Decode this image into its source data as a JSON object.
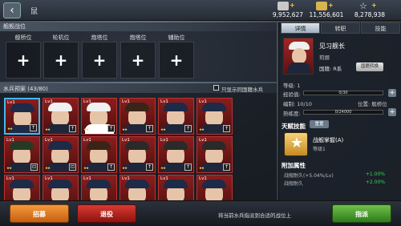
{
  "topbar": {
    "back_icon": "back-arrow-icon",
    "title": "鼠",
    "resources": [
      {
        "name": "fuel-icon",
        "value": "9,952,627",
        "color": "#d7d7d7"
      },
      {
        "name": "ammo-icon",
        "value": "11,556,601",
        "color": "#e0c060"
      },
      {
        "name": "star-icon",
        "value": "8,278,938",
        "color": "#e6e6e6"
      }
    ]
  },
  "formation": {
    "title": "舰舰战位",
    "slots": [
      {
        "label": "舰桥位",
        "plus": "+"
      },
      {
        "label": "轮机位",
        "plus": "+"
      },
      {
        "label": "炮塔位",
        "plus": "+"
      },
      {
        "label": "炮塔位",
        "plus": "+"
      },
      {
        "label": "辅助位",
        "plus": "+"
      }
    ]
  },
  "sailors": {
    "title": "水兵预案 (43/80)",
    "filter_label": "只显示同国籍水兵",
    "cards": [
      {
        "lv": "Lv1",
        "hat": "#1d2a48",
        "body": "#1d2a48",
        "sel": true,
        "tag": "↑"
      },
      {
        "lv": "Lv1",
        "hat": "#f1f1f1",
        "body": "#20263a",
        "sel": false,
        "tag": "↑"
      },
      {
        "lv": "Lv1",
        "hat": "#f1f1f1",
        "body": "#ffffff",
        "sel": false,
        "tag": "↑"
      },
      {
        "lv": "Lv1",
        "hat": "#3a2418",
        "body": "#20263a",
        "sel": false,
        "tag": "↑"
      },
      {
        "lv": "Lv1",
        "hat": "#1d2a48",
        "body": "#20263a",
        "sel": false,
        "tag": "↑"
      },
      {
        "lv": "Lv1",
        "hat": "#1d2a48",
        "body": "#20263a",
        "sel": false,
        "tag": "↑"
      },
      {
        "lv": "Lv1",
        "hat": "#243a24",
        "body": "#20263a",
        "sel": false,
        "tag": "⊡"
      },
      {
        "lv": "Lv1",
        "hat": "#1d2a48",
        "body": "#20263a",
        "sel": false,
        "tag": "⊡"
      },
      {
        "lv": "Lv1",
        "hat": "#3a2418",
        "body": "#20263a",
        "sel": false,
        "tag": "↑"
      },
      {
        "lv": "Lv1",
        "hat": "#2a2a2a",
        "body": "#20263a",
        "sel": false,
        "tag": "↑"
      },
      {
        "lv": "Lv1",
        "hat": "#2a2a2a",
        "body": "#20263a",
        "sel": false,
        "tag": "↑"
      },
      {
        "lv": "Lv1",
        "hat": "#2a2a2a",
        "body": "#20263a",
        "sel": false,
        "tag": "↑"
      },
      {
        "lv": "Lv1",
        "hat": "#1d2a48",
        "body": "#20263a",
        "sel": false,
        "tag": ""
      },
      {
        "lv": "Lv1",
        "hat": "#1d2a48",
        "body": "#20263a",
        "sel": false,
        "tag": ""
      },
      {
        "lv": "Lv1",
        "hat": "#1d2a48",
        "body": "#20263a",
        "sel": false,
        "tag": ""
      },
      {
        "lv": "Lv1",
        "hat": "#1d2a48",
        "body": "#20263a",
        "sel": false,
        "tag": ""
      },
      {
        "lv": "Lv1",
        "hat": "#1d2a48",
        "body": "#20263a",
        "sel": false,
        "tag": ""
      },
      {
        "lv": "Lv1",
        "hat": "#1d2a48",
        "body": "#20263a",
        "sel": false,
        "tag": ""
      }
    ]
  },
  "detail": {
    "tabs": [
      "详情",
      "转职",
      "技能"
    ],
    "name": "见习舰长",
    "subname": "莉娜",
    "nation": "国籍: R系",
    "switch_label": "国籍转换",
    "level_label": "等级: 1",
    "exp_label": "经验值:",
    "exp_text": "0/30",
    "exp_fill": 0,
    "crew_label": "编制: 10/10",
    "position_label": "位置: 舰桥位",
    "skill_label": "熟练度:",
    "skill_text": "0/24000",
    "skill_fill": 0,
    "talent_title": "天赋技能",
    "reset_label": "重置",
    "talent_name": "战舰掌握(A)",
    "talent_level": "等级1",
    "attr_title": "附加属性",
    "attrs": [
      {
        "name": "战舰耐久(+5.04%/Lv)",
        "value": "+1.00%"
      },
      {
        "name": "战舰耐久",
        "value": "+2.00%"
      }
    ]
  },
  "bottom": {
    "recruit": "招募",
    "dismiss": "退役",
    "hint": "将当前水兵指派到合适的战位上",
    "assign": "指派"
  }
}
